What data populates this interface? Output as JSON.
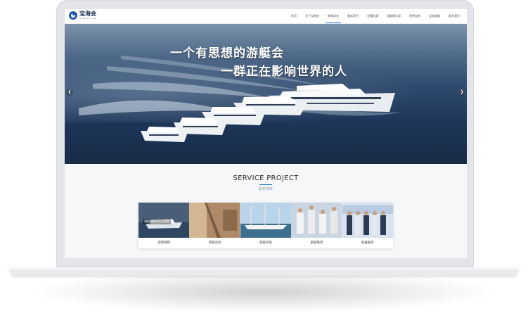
{
  "logo": {
    "name_cn": "宝海会",
    "name_en": "BAOHAI CLUB"
  },
  "nav": {
    "items": [
      {
        "label": "首页"
      },
      {
        "label": "关于宝海会"
      },
      {
        "label": "新闻动态"
      },
      {
        "label": "服务项目"
      },
      {
        "label": "会籍礼遇"
      },
      {
        "label": "游艇俱乐部"
      },
      {
        "label": "视界定制"
      },
      {
        "label": "宝海游艇"
      },
      {
        "label": "联系我们"
      }
    ],
    "active_index": 2
  },
  "banner": {
    "headline_line1": "一个有思想的游艇会",
    "headline_line2": "一群正在影响世界的人",
    "prev_icon": "chevron-left-icon",
    "next_icon": "chevron-right-icon"
  },
  "service": {
    "title": "SERVICE PROJECT",
    "subtitle": "服务项目",
    "cards": [
      {
        "label": "游艇销售",
        "overlay": "游艇销售专业代理商"
      },
      {
        "label": "游艇合购",
        "overlay": ""
      },
      {
        "label": "游艇托管",
        "overlay": ""
      },
      {
        "label": "游艇租赁",
        "overlay": ""
      },
      {
        "label": "会籍服务",
        "overlay": ""
      }
    ]
  },
  "colors": {
    "accent": "#1f6fd1",
    "logo_blue": "#1f5aa6"
  }
}
